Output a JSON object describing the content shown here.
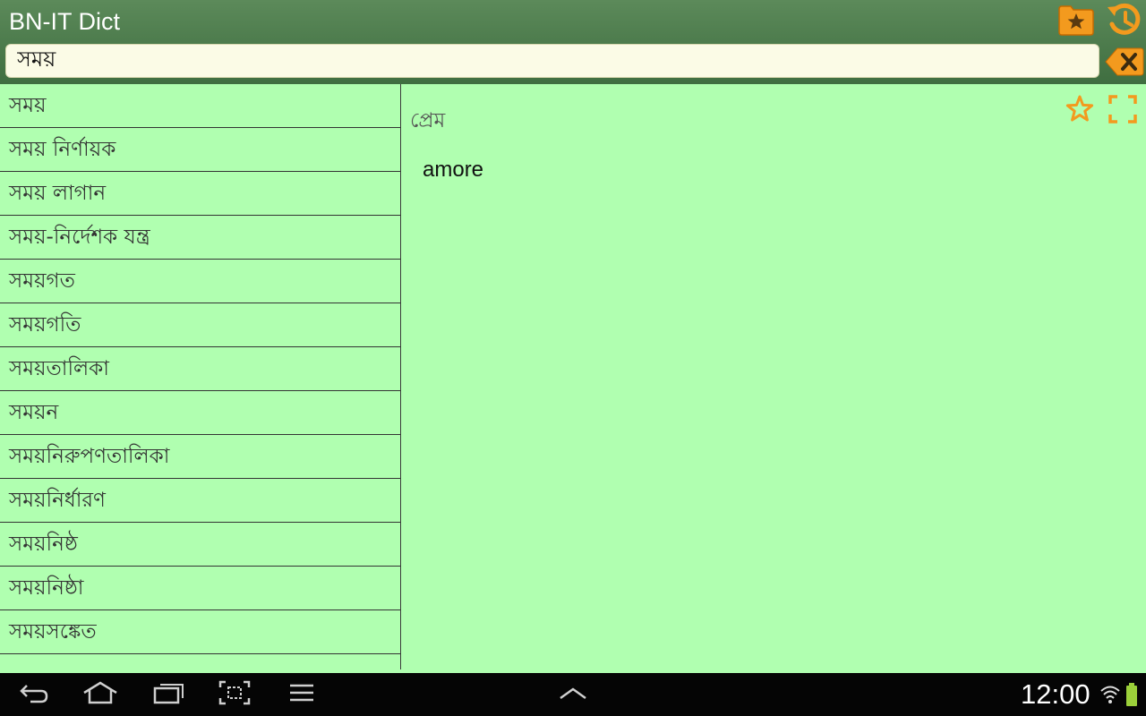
{
  "app": {
    "title": "BN-IT Dict",
    "accent": "#f39a1e",
    "list_bg": "#b0ffb0",
    "header_bg": "#4a7a4a"
  },
  "search": {
    "value": "সময়",
    "clear_icon": "clear-backspace-icon"
  },
  "toolbar": {
    "favorites_icon": "star-folder-icon",
    "history_icon": "history-icon"
  },
  "word_list": [
    {
      "label": "সময়"
    },
    {
      "label": "সময় নির্ণায়ক"
    },
    {
      "label": "সময় লাগান"
    },
    {
      "label": "সময়-নির্দেশক যন্ত্র"
    },
    {
      "label": "সময়গত"
    },
    {
      "label": "সময়গতি"
    },
    {
      "label": "সময়তালিকা"
    },
    {
      "label": "সময়ন"
    },
    {
      "label": "সময়নিরুপণতালিকা"
    },
    {
      "label": "সময়নির্ধারণ"
    },
    {
      "label": "সময়নিষ্ঠ"
    },
    {
      "label": "সময়নিষ্ঠা"
    },
    {
      "label": "সময়সঙ্কেত"
    }
  ],
  "detail": {
    "headword": "প্রেম",
    "translation": "amore",
    "star_icon": "star-outline-icon",
    "fullscreen_icon": "fullscreen-icon"
  },
  "navbar": {
    "back_icon": "back-icon",
    "home_icon": "home-icon",
    "recents_icon": "recent-apps-icon",
    "screenshot_icon": "screenshot-icon",
    "menu_icon": "menu-icon",
    "up_icon": "chevron-up-icon",
    "time": "12:00",
    "wifi_icon": "wifi-icon",
    "battery_icon": "battery-icon"
  }
}
